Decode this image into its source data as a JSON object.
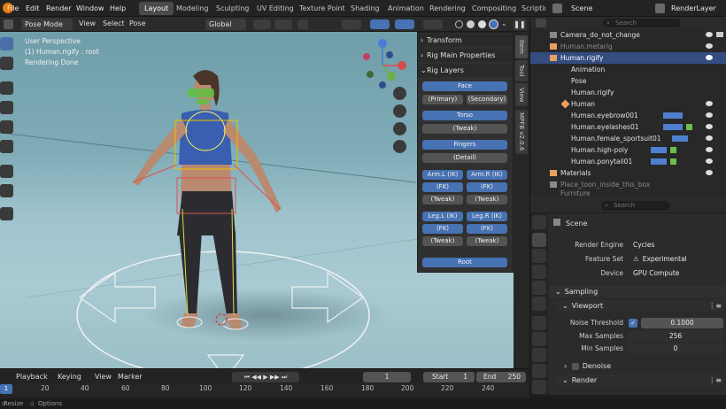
{
  "topbar": {
    "menus": [
      "File",
      "Edit",
      "Render",
      "Window",
      "Help"
    ],
    "workspaces": [
      "Layout",
      "Modeling",
      "Sculpting",
      "UV Editing",
      "Texture Point",
      "Shading",
      "Animation",
      "Rendering",
      "Compositing",
      "Scriptin"
    ],
    "scene": "Scene",
    "view_layer": "RenderLayer"
  },
  "viewport_header": {
    "mode": "Pose Mode",
    "menus": [
      "View",
      "Select",
      "Pose"
    ],
    "orientation": "Global"
  },
  "viewport": {
    "overlay_lines": [
      "User Perspective",
      "(1) Human.rigify : root",
      "Rendering Done"
    ]
  },
  "npanel": {
    "sections": {
      "transform": "Transform",
      "main_props": "Rig Main Properties",
      "rig_layers": "Rig Layers"
    },
    "buttons": {
      "face": "Face",
      "primary": "(Primary)",
      "secondary": "(Secondary)",
      "torso": "Torso",
      "torso_tweak": "(Tweak)",
      "fingers": "Fingers",
      "detail": "(Detail)",
      "arm_l_ik": "Arm.L (IK)",
      "arm_r_ik": "Arm.R (IK)",
      "arm_l_fk": "(FK)",
      "arm_r_fk": "(FK)",
      "arm_l_tweak": "(Tweak)",
      "arm_r_tweak": "(Tweak)",
      "leg_l_ik": "Leg.L (IK)",
      "leg_r_ik": "Leg.R (IK)",
      "leg_l_fk": "(FK)",
      "leg_r_fk": "(FK)",
      "leg_l_tweak": "(Tweak)",
      "leg_r_tweak": "(Tweak)",
      "root": "Root"
    },
    "vertical_tabs": [
      "Item",
      "Tool",
      "View",
      "MPFB v2.0.6"
    ]
  },
  "outliner": {
    "search_placeholder": "Search",
    "rows": [
      {
        "label": "Camera_do_not_change"
      },
      {
        "label": "Human.metarig"
      },
      {
        "label": "Human.rigify"
      },
      {
        "label": "Animation"
      },
      {
        "label": "Pose"
      },
      {
        "label": "Human.rigify"
      },
      {
        "label": "Human"
      },
      {
        "label": "Human.eyebrow001"
      },
      {
        "label": "Human.eyelashes01"
      },
      {
        "label": "Human.female_sportsuit01"
      },
      {
        "label": "Human.high-poly"
      },
      {
        "label": "Human.ponytail01"
      },
      {
        "label": "Materials"
      },
      {
        "label": "Place_toon_inside_this_box"
      },
      {
        "label": "Furniture"
      }
    ]
  },
  "properties": {
    "search_placeholder": "Search",
    "scene_label": "Scene",
    "render_engine_label": "Render Engine",
    "render_engine": "Cycles",
    "feature_set_label": "Feature Set",
    "feature_set": "Experimental",
    "device_label": "Device",
    "device": "GPU Compute",
    "sampling": "Sampling",
    "viewport": "Viewport",
    "noise_threshold_label": "Noise Threshold",
    "noise_threshold": "0.1000",
    "max_samples_label": "Max Samples",
    "max_samples": "256",
    "min_samples_label": "Min Samples",
    "min_samples": "0",
    "denoise": "Denoise",
    "render": "Render"
  },
  "timeline": {
    "menus": [
      "Playback",
      "Keying",
      "View",
      "Marker"
    ],
    "current_frame": "1",
    "start_label": "Start",
    "start": "1",
    "end_label": "End",
    "end": "250",
    "ticks": [
      "1",
      "20",
      "40",
      "60",
      "80",
      "100",
      "120",
      "140",
      "160",
      "180",
      "200",
      "220",
      "240"
    ]
  },
  "statusbar": {
    "resize": "Resize",
    "options": "Options"
  },
  "colors": {
    "accent": "#4772b3",
    "active_row": "#334d80",
    "object_orange": "#e8a060",
    "bone_green": "#7fcf5f"
  }
}
